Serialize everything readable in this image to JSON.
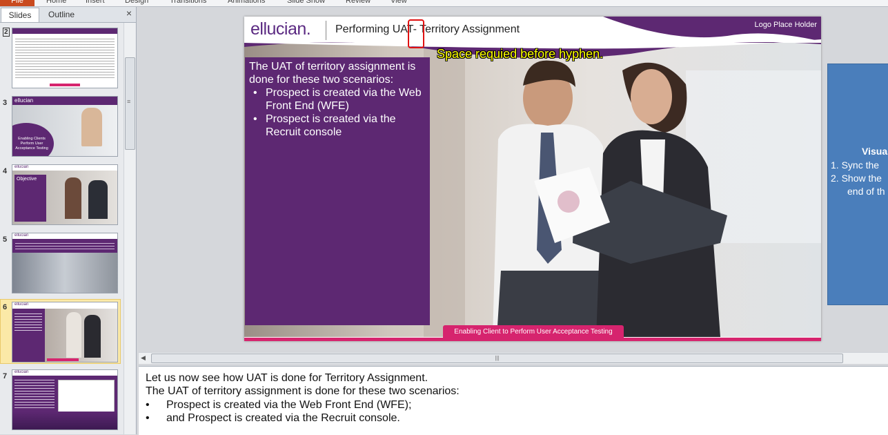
{
  "ribbon": {
    "file": "File",
    "tabs": [
      "Home",
      "Insert",
      "Design",
      "Transitions",
      "Animations",
      "Slide Show",
      "Review",
      "View"
    ]
  },
  "panel": {
    "tab_slides": "Slides",
    "tab_outline": "Outline",
    "close": "×",
    "slide_numbers": [
      "2",
      "3",
      "4",
      "5",
      "6",
      "7"
    ]
  },
  "thumbs": {
    "t3_logo": "ellucian",
    "t3_title": "Enabling Clients Perform User Acceptance Testing",
    "t4_logo": "ellucian",
    "t4_title": "Objective",
    "t5_logo": "ellucian",
    "t6_logo": "ellucian",
    "t7_logo": "ellucian"
  },
  "slide": {
    "logo": "ellucian.",
    "title": "Performing UAT- Territory Assignment",
    "logo_holder": "Logo Place Holder",
    "body_intro": "The UAT of territory assignment is done for these two scenarios:",
    "bullets": [
      "Prospect is created via the Web Front End (WFE)",
      "Prospect is created via the Recruit console"
    ],
    "footer": "Enabling Client to Perform User Acceptance Testing"
  },
  "annotation": "Space requied before hyphen.",
  "side_box": {
    "title": "Visua",
    "item1": "1.  Sync the",
    "item2": "2.  Show the",
    "item2_cont": "end of th"
  },
  "notes": {
    "line1": "Let us now see  how UAT is done for Territory Assignment.",
    "line2": "The UAT of territory assignment is done for these  two scenarios:",
    "bullet1": "Prospect is created  via the Web Front End (WFE);",
    "bullet2": "and Prospect is created via the Recruit console.",
    "bullet_char": "•"
  },
  "colors": {
    "purple": "#5d2872",
    "pink": "#d6246e",
    "annotation": "#ffff00",
    "blue_box": "#4a7ebb"
  }
}
